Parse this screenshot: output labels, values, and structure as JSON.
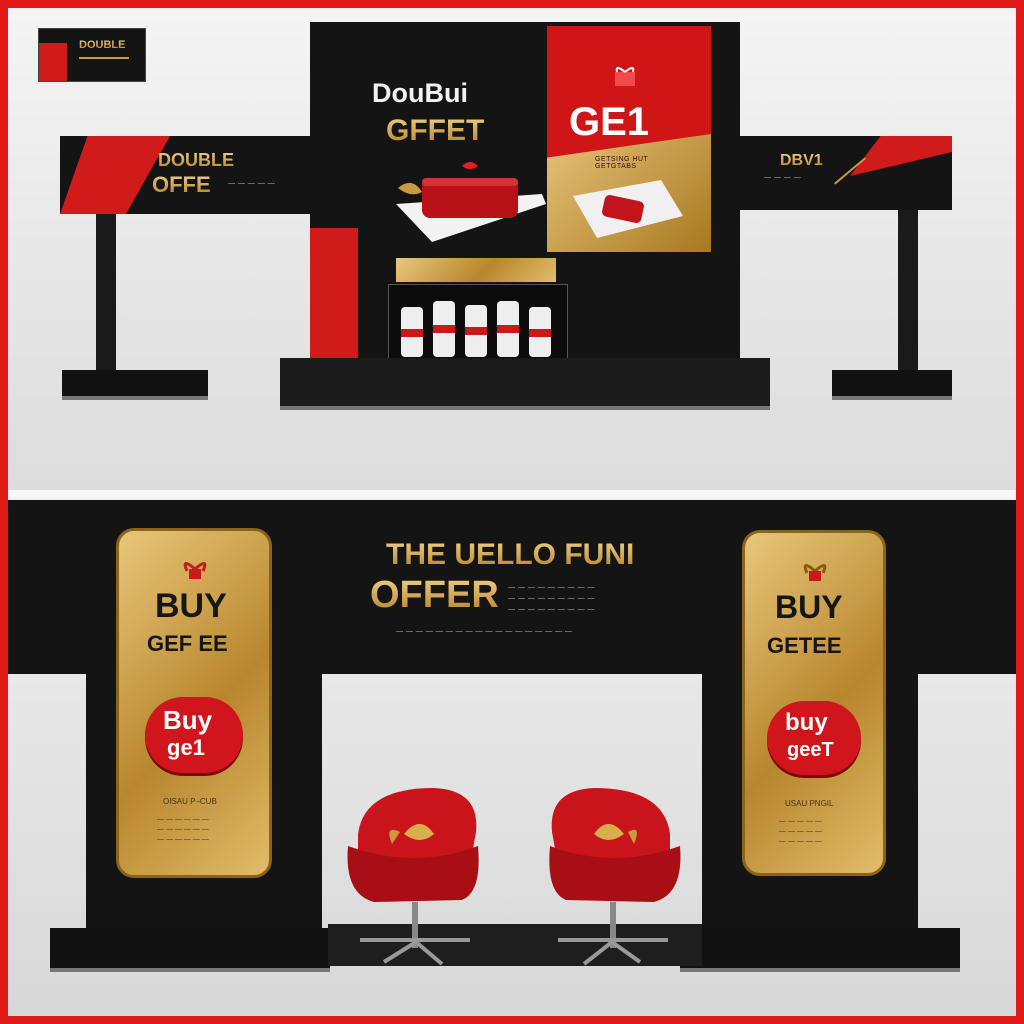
{
  "top_booth": {
    "corner_badge": "DOUBLE",
    "left_sign": {
      "line1": "DOUBLE",
      "line2": "OFFE"
    },
    "center_title": {
      "line1": "DouBui",
      "line2": "GFFET"
    },
    "red_panel": {
      "title": "GE1",
      "caption": "GETSING HUT GETGTABS"
    },
    "right_sign": {
      "label": "DBV1"
    }
  },
  "bottom_booth": {
    "header": {
      "line1": "THE UELLO FUNI",
      "line2": "OFFER"
    },
    "left_panel": {
      "line1": "BUY",
      "line2": "GEF EE",
      "badge_line1": "Buy",
      "badge_line2": "ge1",
      "fine": "OISAU P–CUB"
    },
    "right_panel": {
      "line1": "BUY",
      "line2": "GETEE",
      "badge_line1": "buy",
      "badge_line2": "geeT",
      "fine": "USAU PNGIL"
    }
  },
  "colors": {
    "accent": "#d11a1a",
    "gold": "#c99a3f",
    "black": "#141414"
  },
  "icons": [
    "gift-bow-icon",
    "cake-icon",
    "chair-icon"
  ]
}
